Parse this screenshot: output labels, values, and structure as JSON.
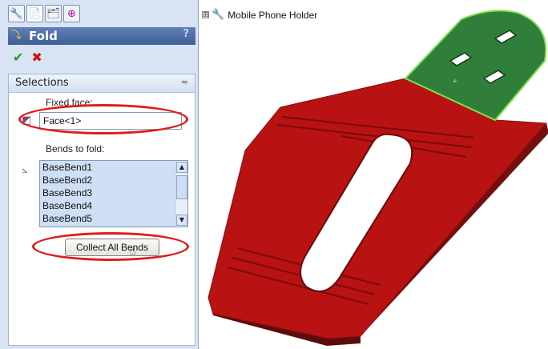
{
  "panel": {
    "title": "Fold",
    "help": "?",
    "tabs": [
      "feature-manager",
      "property-manager",
      "configuration-manager",
      "dimxpert"
    ],
    "section_title": "Selections",
    "collapse_symbol": "≈",
    "fixed_face_label": "Fixed face:",
    "fixed_face_value": "Face<1>",
    "bends_label": "Bends to fold:",
    "bends": [
      "BaseBend1",
      "BaseBend2",
      "BaseBend3",
      "BaseBend4",
      "BaseBend5"
    ],
    "collect_button": "Collect All Bends"
  },
  "tree": {
    "expander": "⊞",
    "part_name": "Mobile Phone Holder"
  },
  "colors": {
    "highlight_red": "#e01b1b",
    "part_red": "#b50f0f",
    "fixed_face_green": "#2f7f3a"
  }
}
